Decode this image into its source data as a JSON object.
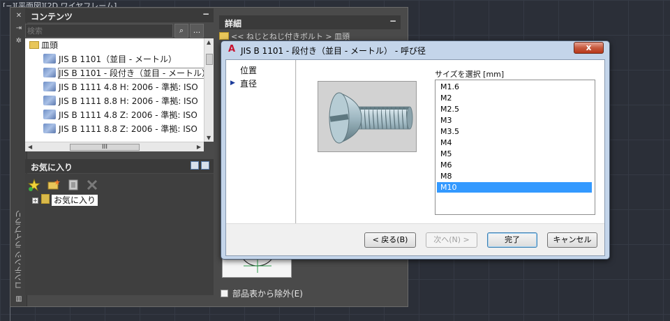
{
  "window": {
    "caption": "[−][平面図][2D ワイヤフレーム]"
  },
  "palette": {
    "strip_title": "コンテンツ ライブラリ",
    "strip_icons": [
      "close-icon",
      "pin-icon",
      "settings-icon",
      "library-icon"
    ],
    "contents": {
      "title": "コンテンツ",
      "collapse": "−",
      "search_placeholder": "検索",
      "more_label": "...",
      "tree": [
        {
          "label": "皿頭",
          "type": "folder"
        },
        {
          "label": "JIS B 1101（並目 - メートル）",
          "type": "part"
        },
        {
          "label": "JIS B 1101 - 段付き（並目 - メートル）",
          "type": "part",
          "selected": true
        },
        {
          "label": "JIS B 1111 4.8 H: 2006 - 準拠: ISO",
          "type": "part"
        },
        {
          "label": "JIS B 1111 8.8 H: 2006 - 準拠: ISO",
          "type": "part"
        },
        {
          "label": "JIS B 1111 4.8 Z: 2006 - 準拠: ISO",
          "type": "part"
        },
        {
          "label": "JIS B 1111 8.8 Z: 2006 - 準拠: ISO",
          "type": "part"
        }
      ],
      "hscroll_grip": "III"
    },
    "favorites": {
      "title": "お気に入り",
      "collapse": "−",
      "node_label": "お気に入り",
      "expander": "+"
    },
    "details": {
      "title": "詳細",
      "collapse": "−",
      "breadcrumb": "<< ねじとねじ付きボルト > 皿頭",
      "exclude_label": "部品表から除外(E)"
    }
  },
  "dialog": {
    "title": "JIS B 1101 - 段付き（並目 - メートル） - 呼び径",
    "app_icon_label": "A",
    "close_label": "x",
    "steps": [
      {
        "label": "位置",
        "current": false
      },
      {
        "label": "直径",
        "current": true
      }
    ],
    "step_marker": "▶",
    "size_label": "サイズを選択 [mm]",
    "sizes": [
      "M1.6",
      "M2",
      "M2.5",
      "M3",
      "M3.5",
      "M4",
      "M5",
      "M6",
      "M8",
      "M10"
    ],
    "selected_size": "M10",
    "buttons": {
      "back": "< 戻る(B)",
      "next": "次へ(N) >",
      "finish": "完了",
      "cancel": "キャンセル"
    },
    "colors": {
      "selection": "#3399ff",
      "close": "#c75a3f"
    }
  }
}
